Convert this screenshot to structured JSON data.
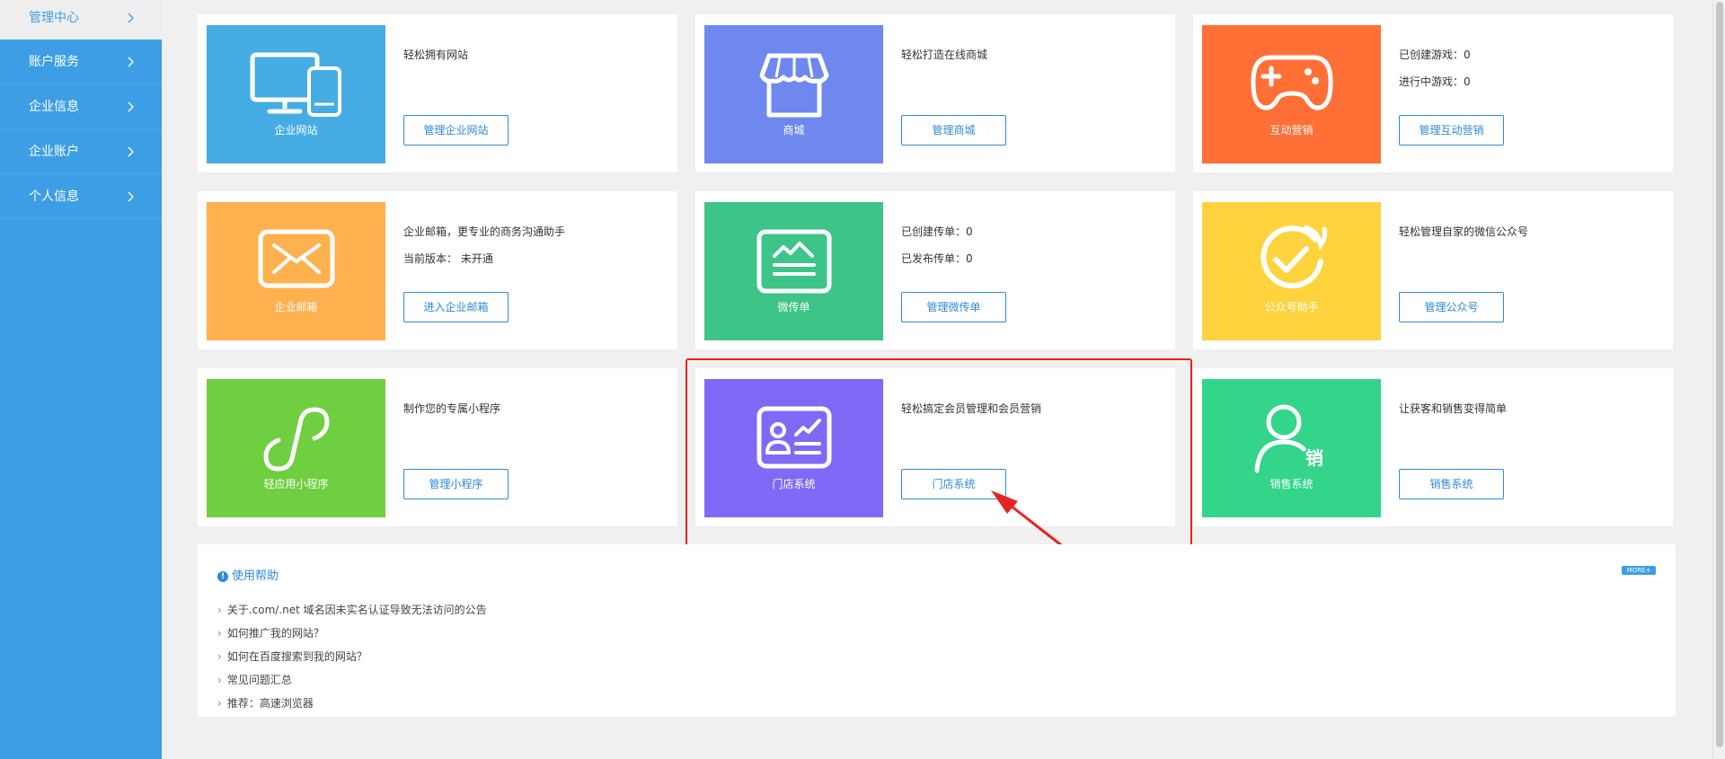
{
  "sidebar": {
    "items": [
      {
        "label": "管理中心"
      },
      {
        "label": "账户服务"
      },
      {
        "label": "企业信息"
      },
      {
        "label": "企业账户"
      },
      {
        "label": "个人信息"
      }
    ]
  },
  "cards": [
    {
      "tile_name": "企业网站",
      "color": "#45ade4",
      "icon": "devices-icon",
      "lines": [
        "轻松拥有网站"
      ],
      "button": "管理企业网站"
    },
    {
      "tile_name": "商城",
      "color": "#6e88ef",
      "icon": "store-icon",
      "lines": [
        "轻松打造在线商城"
      ],
      "button": "管理商城"
    },
    {
      "tile_name": "互动营销",
      "color": "#ff6f36",
      "icon": "gamepad-icon",
      "lines": [
        "已创建游戏：0",
        "进行中游戏：0"
      ],
      "button": "管理互动营销"
    },
    {
      "tile_name": "企业邮箱",
      "color": "#ffb14f",
      "icon": "mail-icon",
      "lines": [
        "企业邮箱，更专业的商务沟通助手",
        "当前版本： 未开通"
      ],
      "button": "进入企业邮箱"
    },
    {
      "tile_name": "微传单",
      "color": "#3dc488",
      "icon": "flyer-icon",
      "lines": [
        "已创建传单：0",
        "已发布传单：0"
      ],
      "button": "管理微传单"
    },
    {
      "tile_name": "公众号助手",
      "color": "#ffd33e",
      "icon": "check-circle-icon",
      "lines": [
        "轻松管理自家的微信公众号"
      ],
      "button": "管理公众号"
    },
    {
      "tile_name": "轻应用小程序",
      "color": "#6fcf40",
      "icon": "miniprogram-icon",
      "lines": [
        "制作您的专属小程序"
      ],
      "button": "管理小程序"
    },
    {
      "tile_name": "门店系统",
      "color": "#7f6af7",
      "icon": "member-card-icon",
      "lines": [
        "轻松搞定会员管理和会员营销"
      ],
      "button": "门店系统"
    },
    {
      "tile_name": "销售系统",
      "color": "#33d58a",
      "icon": "sales-person-icon",
      "lines": [
        "让获客和销售变得简单"
      ],
      "button": "销售系统",
      "badge": "销"
    }
  ],
  "help": {
    "title": "使用帮助",
    "more": "MORE+",
    "items": [
      "关于.com/.net 域名因未实名认证导致无法访问的公告",
      "如何推广我的网站？",
      "如何在百度搜索到我的网站？",
      "常见问题汇总",
      "推荐：高速浏览器"
    ]
  },
  "colors": {
    "sidebar": "#3d9ee6",
    "accent": "#2e8ad8",
    "highlight": "#e82222"
  }
}
